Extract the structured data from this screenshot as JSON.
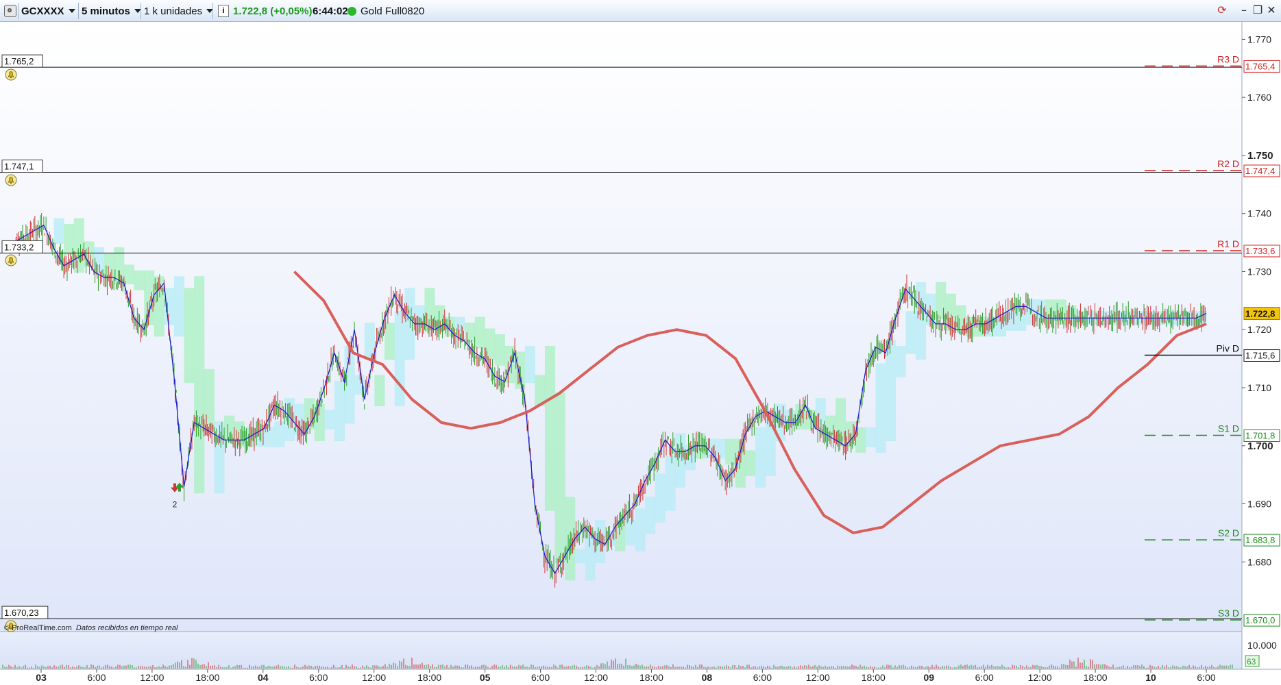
{
  "toolbar": {
    "symbol": "GCXXXX",
    "timeframe": "5 minutos",
    "units": "1 k unidades",
    "price": "1.722,8",
    "change": "(+0,05%)",
    "time": "6:44:02",
    "instrument": "Gold Full0820"
  },
  "icons": {
    "settings": "gear-icon",
    "info": "info-icon",
    "status": "live-status-dot",
    "refresh": "refresh-icon",
    "minimize": "minimize-icon",
    "restore": "restore-icon",
    "close": "close-icon",
    "alert": "bell-icon"
  },
  "colors": {
    "up_candle": "#2e9e2e",
    "down_candle": "#d23232",
    "ma": "#d9605a",
    "fast_line": "#1a1acc",
    "resistance": "#d42020",
    "support": "#1f8a1f",
    "pivot": "#111111",
    "cloud_bull": "#a8f0c0",
    "cloud_bear": "#b6ecf6",
    "last_price_bg": "#f2c40c"
  },
  "chart": {
    "y_axis_ticks": [
      {
        "value": 1770,
        "label": "1.770",
        "bold": false
      },
      {
        "value": 1760,
        "label": "1.760",
        "bold": false
      },
      {
        "value": 1750,
        "label": "1.750",
        "bold": true
      },
      {
        "value": 1740,
        "label": "1.740",
        "bold": false
      },
      {
        "value": 1730,
        "label": "1.730",
        "bold": false
      },
      {
        "value": 1720,
        "label": "1.720",
        "bold": false
      },
      {
        "value": 1710,
        "label": "1.710",
        "bold": false
      },
      {
        "value": 1700,
        "label": "1.700",
        "bold": true
      },
      {
        "value": 1690,
        "label": "1.690",
        "bold": false
      },
      {
        "value": 1680,
        "label": "1.680",
        "bold": false
      }
    ],
    "alert_lines": [
      {
        "value": 1765.2,
        "label": "1.765,2"
      },
      {
        "value": 1747.1,
        "label": "1.747,1"
      },
      {
        "value": 1733.2,
        "label": "1.733,2"
      },
      {
        "value": 1670.23,
        "label": "1.670,23"
      }
    ],
    "pivot_levels": [
      {
        "name": "R3 D",
        "value": 1765.4,
        "label": "1.765,4",
        "kind": "resistance"
      },
      {
        "name": "R2 D",
        "value": 1747.4,
        "label": "1.747,4",
        "kind": "resistance"
      },
      {
        "name": "R1 D",
        "value": 1733.6,
        "label": "1.733,6",
        "kind": "resistance"
      },
      {
        "name": "Piv D",
        "value": 1715.6,
        "label": "1.715,6",
        "kind": "pivot"
      },
      {
        "name": "S1 D",
        "value": 1701.8,
        "label": "1.701,8",
        "kind": "support"
      },
      {
        "name": "S2 D",
        "value": 1683.8,
        "label": "1.683,8",
        "kind": "support"
      },
      {
        "name": "S3 D",
        "value": 1670.0,
        "label": "1.670,0",
        "kind": "support"
      }
    ],
    "last_price": {
      "value": 1722.8,
      "label": "1.722,8"
    },
    "x_axis_labels": [
      {
        "index": 0,
        "label": "03",
        "bold": true
      },
      {
        "index": 1,
        "label": "6:00",
        "bold": false
      },
      {
        "index": 2,
        "label": "12:00",
        "bold": false
      },
      {
        "index": 3,
        "label": "18:00",
        "bold": false
      },
      {
        "index": 4,
        "label": "04",
        "bold": true
      },
      {
        "index": 5,
        "label": "6:00",
        "bold": false
      },
      {
        "index": 6,
        "label": "12:00",
        "bold": false
      },
      {
        "index": 7,
        "label": "18:00",
        "bold": false
      },
      {
        "index": 8,
        "label": "05",
        "bold": true
      },
      {
        "index": 9,
        "label": "6:00",
        "bold": false
      },
      {
        "index": 10,
        "label": "12:00",
        "bold": false
      },
      {
        "index": 11,
        "label": "18:00",
        "bold": false
      },
      {
        "index": 12,
        "label": "08",
        "bold": true
      },
      {
        "index": 13,
        "label": "6:00",
        "bold": false
      },
      {
        "index": 14,
        "label": "12:00",
        "bold": false
      },
      {
        "index": 15,
        "label": "18:00",
        "bold": false
      },
      {
        "index": 16,
        "label": "09",
        "bold": true
      },
      {
        "index": 17,
        "label": "6:00",
        "bold": false
      },
      {
        "index": 18,
        "label": "12:00",
        "bold": false
      },
      {
        "index": 19,
        "label": "18:00",
        "bold": false
      },
      {
        "index": 20,
        "label": "10",
        "bold": true
      },
      {
        "index": 21,
        "label": "6:00",
        "bold": false
      }
    ],
    "signal_marker": {
      "label": "2"
    },
    "volume": {
      "axis_label": "10.000",
      "current": "63"
    }
  },
  "footer": {
    "source": "© ProRealTime.com",
    "realtime": "Datos recibidos en tiempo real"
  },
  "chart_data": {
    "type": "line",
    "title": "",
    "series": [
      {
        "name": "",
        "x": [
          0,
          1,
          2,
          3,
          4,
          5,
          6,
          7,
          8,
          9,
          10,
          11,
          12,
          13,
          14,
          15,
          16,
          17,
          18,
          19,
          20,
          21,
          22,
          23,
          24,
          25,
          26,
          27,
          28,
          29,
          30,
          31,
          32,
          33,
          34,
          35,
          36,
          37,
          38,
          39,
          40,
          41,
          42,
          43,
          44,
          45,
          46,
          47,
          48,
          49,
          50,
          51,
          52,
          53,
          54,
          55,
          56,
          57,
          58,
          59,
          60,
          61,
          62,
          63,
          64,
          65,
          66,
          67,
          68,
          69,
          70,
          71,
          72,
          73,
          74,
          75,
          76,
          77,
          78,
          79,
          80,
          81,
          82,
          83,
          84,
          85,
          86,
          87,
          88,
          89,
          90,
          91,
          92,
          93,
          94,
          95,
          96,
          97,
          98,
          99,
          100,
          101,
          102,
          103,
          104,
          105,
          106,
          107,
          108,
          109,
          110,
          111,
          112,
          113,
          114,
          115,
          116,
          117,
          118,
          119
        ],
        "values": [
          1735,
          1736,
          1737,
          1738,
          1734,
          1731,
          1732,
          1733,
          1730,
          1729,
          1729,
          1728,
          1722,
          1720,
          1726,
          1728,
          1712,
          1693,
          1704,
          1703,
          1702,
          1701,
          1701,
          1701,
          1702,
          1703,
          1707,
          1706,
          1704,
          1702,
          1705,
          1710,
          1716,
          1711,
          1720,
          1708,
          1716,
          1722,
          1726,
          1723,
          1721,
          1721,
          1720,
          1721,
          1719,
          1718,
          1716,
          1715,
          1712,
          1711,
          1716,
          1708,
          1690,
          1681,
          1678,
          1681,
          1684,
          1686,
          1684,
          1683,
          1686,
          1688,
          1690,
          1694,
          1697,
          1701,
          1699,
          1699,
          1700,
          1700,
          1698,
          1694,
          1696,
          1702,
          1705,
          1706,
          1705,
          1704,
          1704,
          1707,
          1703,
          1702,
          1701,
          1700,
          1702,
          1713,
          1717,
          1716,
          1722,
          1727,
          1725,
          1723,
          1721,
          1721,
          1720,
          1720,
          1721,
          1721,
          1722,
          1723,
          1724,
          1724,
          1723,
          1722,
          1722,
          1722,
          1722,
          1722,
          1722,
          1722,
          1722,
          1722,
          1722,
          1722,
          1722,
          1722,
          1722,
          1722,
          1722,
          1722.8
        ]
      },
      {
        "name": "",
        "x_start": 28,
        "x_end": 119,
        "values": [
          1730,
          1725,
          1716,
          1714,
          1708,
          1704,
          1703,
          1704,
          1706,
          1709,
          1713,
          1717,
          1719,
          1720,
          1719,
          1715,
          1706,
          1696,
          1688,
          1685,
          1686,
          1690,
          1694,
          1697,
          1700,
          1701,
          1702,
          1705,
          1710,
          1714,
          1719,
          1721
        ]
      }
    ],
    "ylim": [
      1668,
      1773
    ],
    "xlabel": "",
    "ylabel": ""
  }
}
